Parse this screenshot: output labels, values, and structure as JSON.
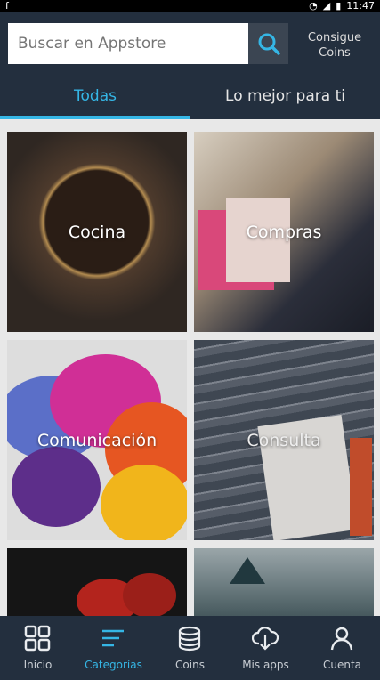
{
  "status_bar": {
    "time": "11:47"
  },
  "header": {
    "search_placeholder": "Buscar en Appstore",
    "coins_link": "Consigue Coins"
  },
  "tabs": {
    "all": "Todas",
    "best": "Lo mejor para ti"
  },
  "categories": [
    {
      "label": "Cocina",
      "bg": "#3a2b22"
    },
    {
      "label": "Compras",
      "bg": "#6f6a62"
    },
    {
      "label": "Comunicación",
      "bg": "#9c3d8a"
    },
    {
      "label": "Consulta",
      "bg": "#49505b"
    },
    {
      "label": "",
      "bg": "#272727"
    },
    {
      "label": "",
      "bg": "#5f6f72"
    }
  ],
  "bottom_nav": [
    {
      "label": "Inicio",
      "icon": "grid-icon"
    },
    {
      "label": "Categorías",
      "icon": "categories-icon",
      "active": true
    },
    {
      "label": "Coins",
      "icon": "coins-icon"
    },
    {
      "label": "Mis apps",
      "icon": "cloud-download-icon"
    },
    {
      "label": "Cuenta",
      "icon": "account-icon"
    }
  ],
  "colors": {
    "header_bg": "#232f3e",
    "accent": "#35b6e5"
  }
}
